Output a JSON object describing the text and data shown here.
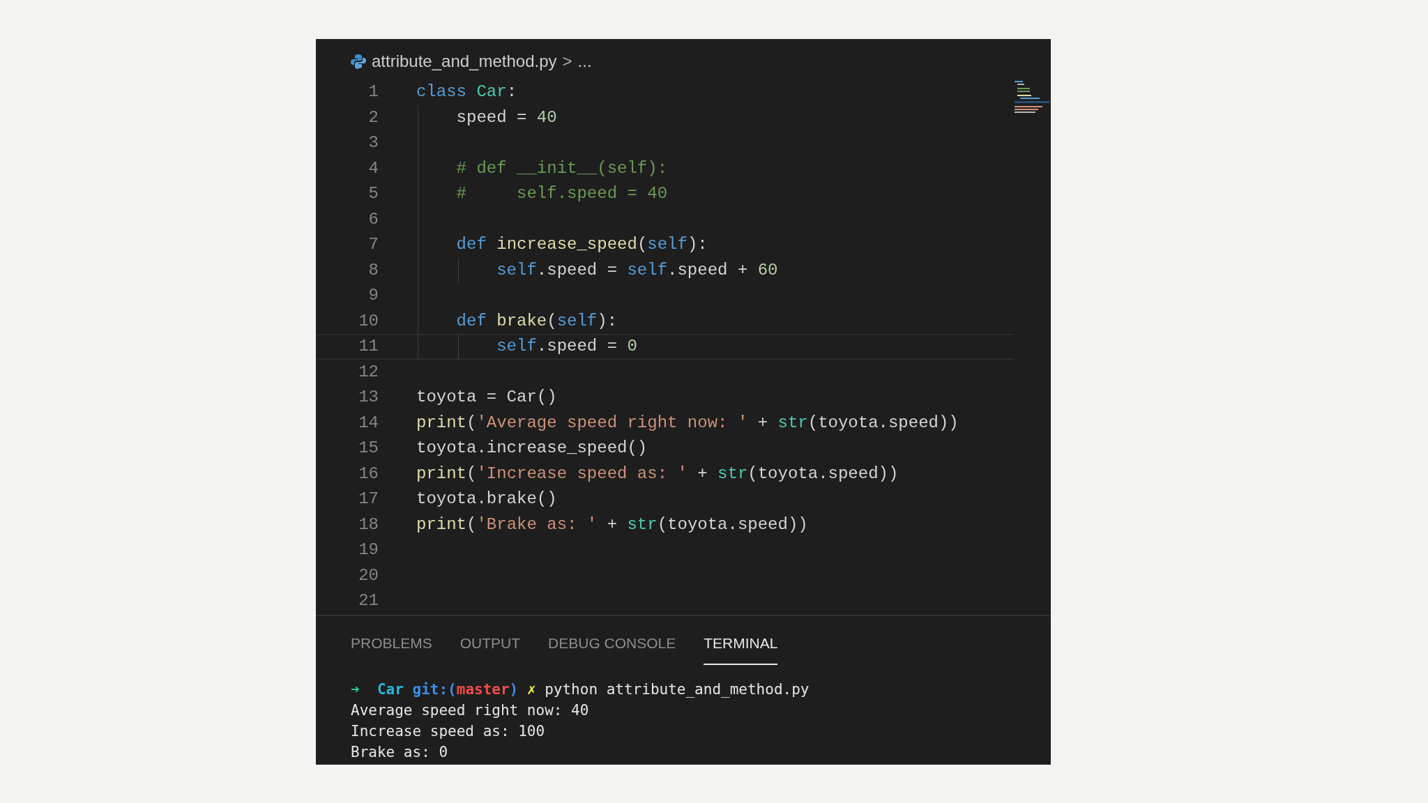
{
  "breadcrumb": {
    "file": "attribute_and_method.py",
    "separator": ">",
    "rest": "..."
  },
  "lines": [
    {
      "number": "1",
      "current": false,
      "tokens": [
        {
          "kind": "kw",
          "text": "class"
        },
        {
          "kind": "type",
          "text": " Car"
        },
        {
          "kind": "plain",
          "text": ":"
        }
      ]
    },
    {
      "number": "2",
      "current": false,
      "tokens": [
        {
          "kind": "plain",
          "text": "    speed = "
        },
        {
          "kind": "num",
          "text": "40"
        }
      ]
    },
    {
      "number": "3",
      "current": false
    },
    {
      "number": "4",
      "current": false,
      "tokens": [
        {
          "kind": "comment",
          "text": "    # def __init__(self):"
        }
      ]
    },
    {
      "number": "5",
      "current": false,
      "tokens": [
        {
          "kind": "comment",
          "text": "    #     self.speed = 40"
        }
      ]
    },
    {
      "number": "6",
      "current": false
    },
    {
      "number": "7",
      "current": false,
      "tokens": [
        {
          "kind": "kw",
          "text": "    def"
        },
        {
          "kind": "func",
          "text": " increase_speed"
        },
        {
          "kind": "plain",
          "text": "("
        },
        {
          "kind": "kw",
          "text": "self"
        },
        {
          "kind": "plain",
          "text": "):"
        }
      ]
    },
    {
      "number": "8",
      "current": false,
      "tokens": [
        {
          "kind": "kw",
          "text": "        self"
        },
        {
          "kind": "plain",
          "text": ".speed = "
        },
        {
          "kind": "kw",
          "text": "self"
        },
        {
          "kind": "plain",
          "text": ".speed + "
        },
        {
          "kind": "num",
          "text": "60"
        }
      ]
    },
    {
      "number": "9",
      "current": false
    },
    {
      "number": "10",
      "current": false,
      "tokens": [
        {
          "kind": "kw",
          "text": "    def"
        },
        {
          "kind": "func",
          "text": " brake"
        },
        {
          "kind": "plain",
          "text": "("
        },
        {
          "kind": "kw",
          "text": "self"
        },
        {
          "kind": "plain",
          "text": "):"
        }
      ]
    },
    {
      "number": "11",
      "current": true,
      "tokens": [
        {
          "kind": "kw",
          "text": "        self"
        },
        {
          "kind": "plain",
          "text": ".speed = "
        },
        {
          "kind": "num",
          "text": "0"
        }
      ]
    },
    {
      "number": "12",
      "current": false
    },
    {
      "number": "13",
      "current": false,
      "tokens": [
        {
          "kind": "plain",
          "text": "toyota = Car()"
        }
      ]
    },
    {
      "number": "14",
      "current": false,
      "tokens": [
        {
          "kind": "func",
          "text": "print"
        },
        {
          "kind": "plain",
          "text": "("
        },
        {
          "kind": "str",
          "text": "'Average speed right now: '"
        },
        {
          "kind": "plain",
          "text": " + "
        },
        {
          "kind": "type",
          "text": "str"
        },
        {
          "kind": "plain",
          "text": "(toyota.speed))"
        }
      ]
    },
    {
      "number": "15",
      "current": false,
      "tokens": [
        {
          "kind": "plain",
          "text": "toyota.increase_speed()"
        }
      ]
    },
    {
      "number": "16",
      "current": false,
      "tokens": [
        {
          "kind": "func",
          "text": "print"
        },
        {
          "kind": "plain",
          "text": "("
        },
        {
          "kind": "str",
          "text": "'Increase speed as: '"
        },
        {
          "kind": "plain",
          "text": " + "
        },
        {
          "kind": "type",
          "text": "str"
        },
        {
          "kind": "plain",
          "text": "(toyota.speed))"
        }
      ]
    },
    {
      "number": "17",
      "current": false,
      "tokens": [
        {
          "kind": "plain",
          "text": "toyota.brake()"
        }
      ]
    },
    {
      "number": "18",
      "current": false,
      "tokens": [
        {
          "kind": "func",
          "text": "print"
        },
        {
          "kind": "plain",
          "text": "("
        },
        {
          "kind": "str",
          "text": "'Brake as: '"
        },
        {
          "kind": "plain",
          "text": " + "
        },
        {
          "kind": "type",
          "text": "str"
        },
        {
          "kind": "plain",
          "text": "(toyota.speed))"
        }
      ]
    },
    {
      "number": "19",
      "current": false
    },
    {
      "number": "20",
      "current": false
    },
    {
      "number": "21",
      "current": false
    }
  ],
  "panel_tabs": [
    {
      "label": "PROBLEMS",
      "selected": false
    },
    {
      "label": "OUTPUT",
      "selected": false
    },
    {
      "label": "DEBUG CONSOLE",
      "selected": false
    },
    {
      "label": "TERMINAL",
      "selected": true
    }
  ],
  "terminal": [
    {
      "tokens": [
        {
          "kind": "arrow",
          "text": "➜"
        },
        {
          "kind": "dir",
          "text": "  Car"
        },
        {
          "kind": "git",
          "text": " git:("
        },
        {
          "kind": "branch",
          "text": "master"
        },
        {
          "kind": "git",
          "text": ")"
        },
        {
          "kind": "dirty",
          "text": " ✗"
        },
        {
          "kind": "plain",
          "text": " python attribute_and_method.py"
        }
      ]
    },
    {
      "tokens": [
        {
          "kind": "plain",
          "text": "Average speed right now: 40"
        }
      ]
    },
    {
      "tokens": [
        {
          "kind": "plain",
          "text": "Increase speed as: 100"
        }
      ]
    },
    {
      "tokens": [
        {
          "kind": "plain",
          "text": "Brake as: 0"
        }
      ]
    }
  ]
}
